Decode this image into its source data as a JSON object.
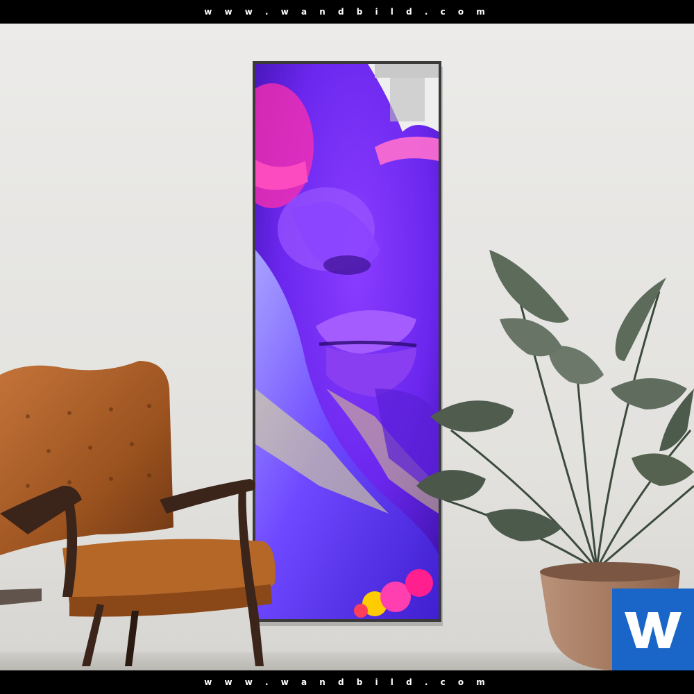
{
  "header": {
    "site_text": "w w w . w a n d b i l d . c o m"
  },
  "footer": {
    "site_text": "w w w . w a n d b i l d . c o m"
  },
  "scene": {
    "wall_color": "#e4e3e0",
    "floor_color": "#c9c8c4",
    "artwork": {
      "subject": "close-up face with neon purple, pink and yellow paint",
      "primary_color": "#7b2cff",
      "accent_colors": [
        "#ff2fae",
        "#f4f06a",
        "#5ad7ff"
      ]
    },
    "chair": {
      "upholstery": "#a35a22",
      "wood": "#3b241a"
    },
    "plant": {
      "leaf": "#5d6b5b",
      "pot": "#a98067"
    }
  },
  "badge": {
    "letter": "W",
    "color": "#1a66c8"
  }
}
